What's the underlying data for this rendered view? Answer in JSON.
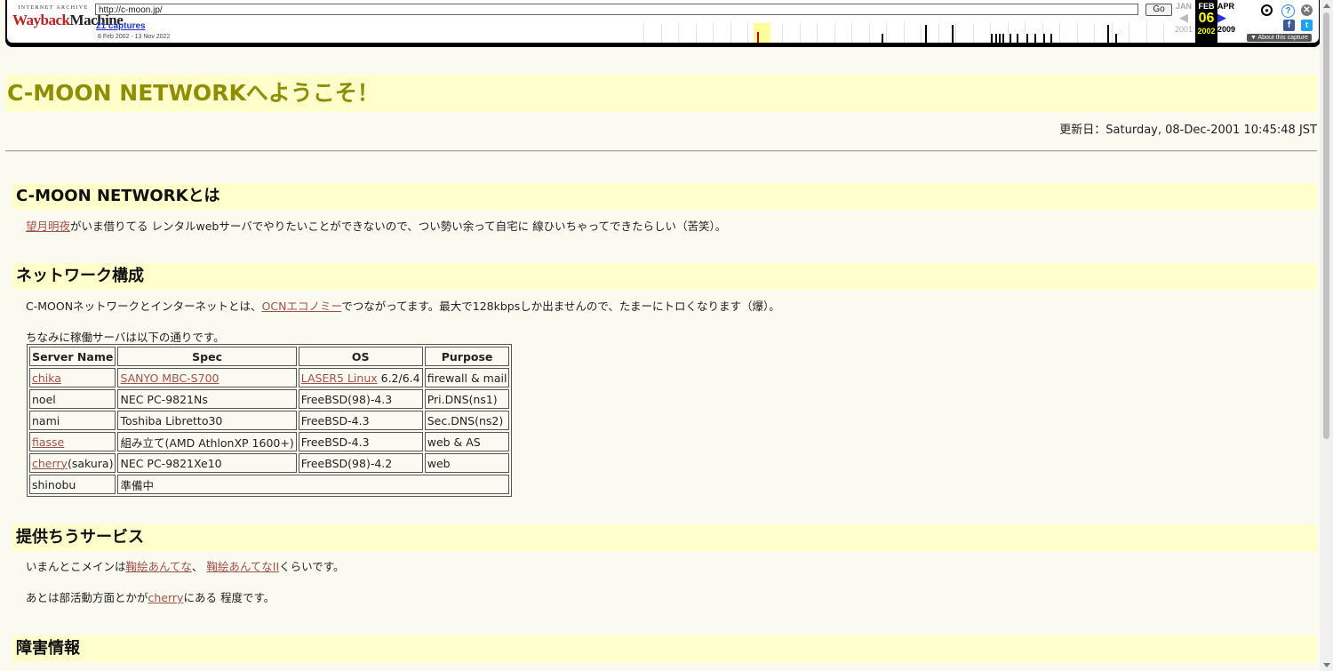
{
  "wayback": {
    "logo_top": "INTERNET ARCHIVE",
    "logo_main_a": "Wayback",
    "logo_main_b": "Machine",
    "url": "http://c-moon.jp/",
    "go_label": "Go",
    "captures": "21 captures",
    "date_range": "8 Feb 2002 - 13 Nov 2022",
    "prev": {
      "month": "JAN",
      "year": "2001"
    },
    "current": {
      "month": "FEB",
      "day": "06",
      "year": "2002"
    },
    "next": {
      "month": "APR",
      "year": "2009"
    },
    "about": "▼ About this capture",
    "icons": [
      "user-icon",
      "help-icon",
      "close-icon",
      "facebook-icon",
      "twitter-icon"
    ]
  },
  "page": {
    "title": "C-MOON NETWORKへようこそ！",
    "updated": "更新日：Saturday, 08-Dec-2001 10:45:48 JST",
    "about": {
      "heading": "C-MOON NETWORKとは",
      "link": "望月明夜",
      "text": "がいま借りてる レンタルwebサーバでやりたいことができないので、つい勢い余って自宅に 線ひいちゃってできたらしい（苦笑）。"
    },
    "network": {
      "heading": "ネットワーク構成",
      "text_before": "C-MOONネットワークとインターネットとは、",
      "link": "OCNエコノミー",
      "text_after": "でつながってます。最大で128kbpsしか出ませんので、たまーにトロくなります（爆）。",
      "table_intro": "ちなみに稼働サーバは以下の通りです。",
      "columns": [
        "Server Name",
        "Spec",
        "OS",
        "Purpose"
      ],
      "rows": [
        {
          "name": "chika",
          "name_link": true,
          "name_suffix": "",
          "spec": "SANYO MBC-S700",
          "spec_link": true,
          "os": "LASER5 Linux",
          "os_link": true,
          "os_suffix": " 6.2/6.4",
          "purpose": "firewall & mail"
        },
        {
          "name": "noel",
          "name_link": false,
          "name_suffix": "",
          "spec": "NEC PC-9821Ns",
          "spec_link": false,
          "os": "FreeBSD(98)-4.3",
          "os_link": false,
          "os_suffix": "",
          "purpose": "Pri.DNS(ns1)"
        },
        {
          "name": "nami",
          "name_link": false,
          "name_suffix": "",
          "spec": "Toshiba Libretto30",
          "spec_link": false,
          "os": "FreeBSD-4.3",
          "os_link": false,
          "os_suffix": "",
          "purpose": "Sec.DNS(ns2)"
        },
        {
          "name": "fiasse",
          "name_link": true,
          "name_suffix": "",
          "spec": "組み立て(AMD AthlonXP 1600+)",
          "spec_link": false,
          "os": "FreeBSD-4.3",
          "os_link": false,
          "os_suffix": "",
          "purpose": "web & AS"
        },
        {
          "name": "cherry",
          "name_link": true,
          "name_suffix": "(sakura)",
          "spec": "NEC PC-9821Xe10",
          "spec_link": false,
          "os": "FreeBSD(98)-4.2",
          "os_link": false,
          "os_suffix": "",
          "purpose": "web"
        }
      ],
      "last_row": {
        "name": "shinobu",
        "note": "準備中"
      }
    },
    "services": {
      "heading": "提供ちうサービス",
      "line1_before": "いまんとこメインは",
      "line1_link1": "鞠絵あんてな",
      "line1_sep": "、 ",
      "line1_link2": "鞠絵あんてなII",
      "line1_after": "くらいです。",
      "line2_before": "あとは部活動方面とかが",
      "line2_link": "cherry",
      "line2_after": "にある 程度です。"
    },
    "failure": {
      "heading": "障害情報"
    }
  }
}
